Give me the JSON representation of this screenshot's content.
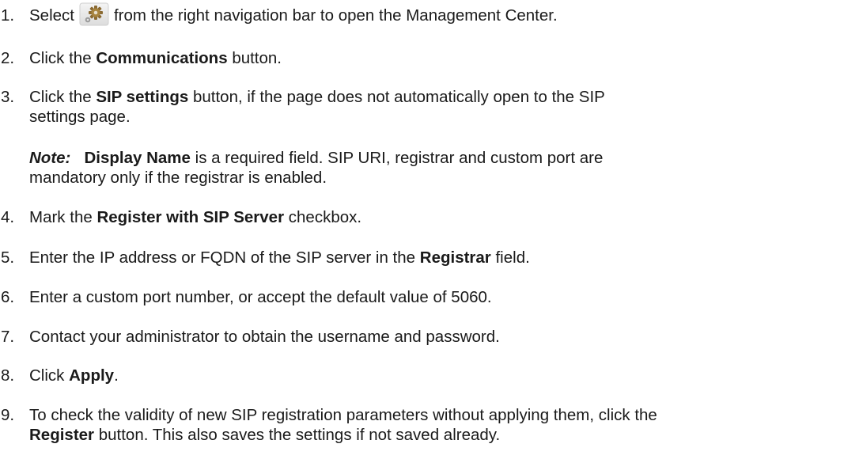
{
  "steps": [
    {
      "number": "1.",
      "before_icon": "Select",
      "icon": "gear-icon",
      "after_icon": "from the right navigation bar to open the Management Center."
    },
    {
      "number": "2.",
      "pre": "Click the",
      "bold": "Communications",
      "post": "button."
    },
    {
      "number": "3.",
      "pre": "Click the",
      "bold": "SIP settings",
      "post": "button, if the page does not automatically open to the SIP",
      "post2": "settings page."
    },
    {
      "number": "4.",
      "pre": "Mark the",
      "bold": "Register with SIP Server",
      "post": "checkbox."
    },
    {
      "number": "5.",
      "pre": "Enter the IP address or FQDN of the SIP server in the",
      "bold": "Registrar",
      "post": "field."
    },
    {
      "number": "6.",
      "text": "Enter a custom port number, or accept the default value of 5060."
    },
    {
      "number": "7.",
      "text": "Contact your administrator to obtain the username and password."
    },
    {
      "number": "8.",
      "pre": "Click",
      "bold": "Apply",
      "post": "."
    },
    {
      "number": "9.",
      "line1": "To check the validity of new SIP registration parameters without applying them, click the",
      "bold": "Register",
      "post": "button. This also saves the settings if not saved already."
    }
  ],
  "note": {
    "label": "Note:",
    "bold": "Display Name",
    "line1_rest": "is a required field. SIP URI, registrar and custom port are",
    "line2": "mandatory only if the registrar is enabled."
  }
}
